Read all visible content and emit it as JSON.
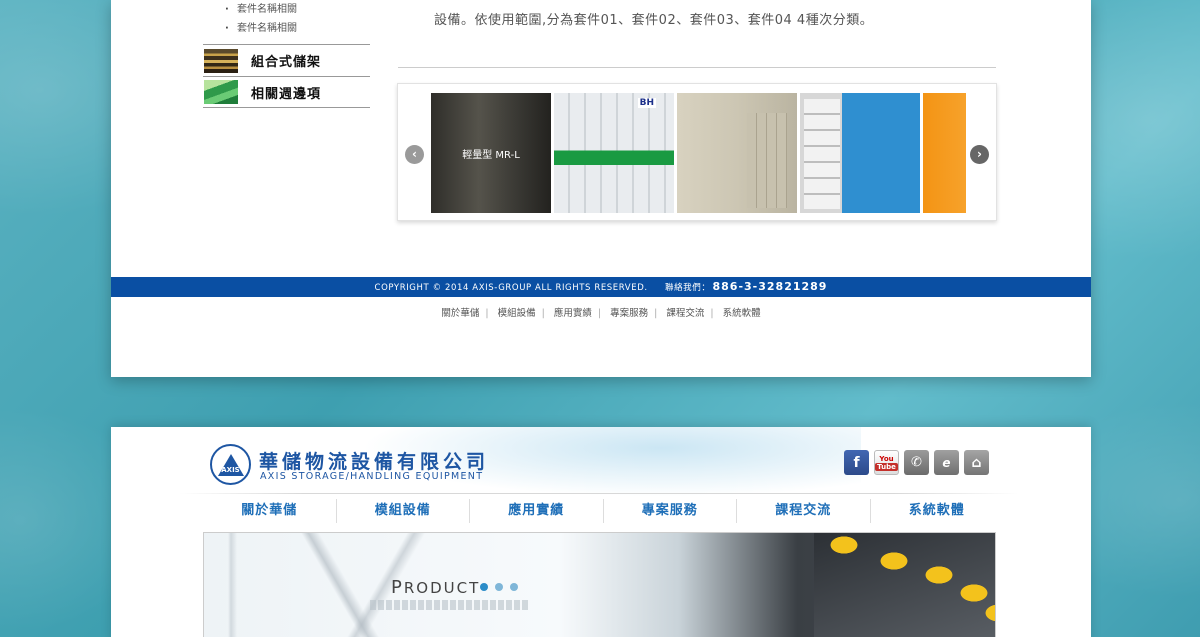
{
  "sidebar": {
    "sub_items": [
      "套件名稱相關",
      "套件名稱相關"
    ],
    "categories": [
      {
        "label": "組合式儲架",
        "icon": "shelf-thumbnail"
      },
      {
        "label": "相關週邊項",
        "icon": "green-panel-thumbnail"
      }
    ]
  },
  "content": {
    "desc_top": "...",
    "description": "設備。依使用範圍,分為套件01、套件02、套件03、套件04 4種次分類。"
  },
  "carousel": {
    "prev_icon": "chevron-left-icon",
    "next_icon": "chevron-right-icon",
    "slides": [
      {
        "caption": "輕量型 MR-L"
      },
      {
        "caption": ""
      },
      {
        "caption": ""
      },
      {
        "caption": ""
      },
      {
        "caption": ""
      }
    ],
    "slide2_brand": "BH"
  },
  "footer": {
    "copyright": "COPYRIGHT © 2014 AXIS-GROUP ALL RIGHTS RESERVED.",
    "contact_label": "聯絡我們：",
    "phone": "886-3-32821289",
    "bar_color": "#0a4fa3",
    "links": [
      "關於華儲",
      "模組設備",
      "應用實績",
      "專案服務",
      "課程交流",
      "系統軟體"
    ]
  },
  "header2": {
    "company_cn": "華儲物流設備有限公司",
    "company_en": "AXIS STORAGE/HANDLING EQUIPMENT",
    "logo_text": "AXIS",
    "social": [
      {
        "name": "facebook-icon",
        "glyph": "f"
      },
      {
        "name": "youtube-icon",
        "top": "You",
        "bottom": "Tube"
      },
      {
        "name": "phone-icon",
        "glyph": "✆"
      },
      {
        "name": "epaper-icon",
        "glyph": "e"
      },
      {
        "name": "home-icon",
        "glyph": "⌂"
      }
    ],
    "menu": [
      "關於華儲",
      "模組設備",
      "應用實績",
      "專案服務",
      "課程交流",
      "系統軟體"
    ],
    "brand_color": "#1e56a3"
  },
  "banner": {
    "title_first": "P",
    "title_rest": "RODUCT"
  }
}
